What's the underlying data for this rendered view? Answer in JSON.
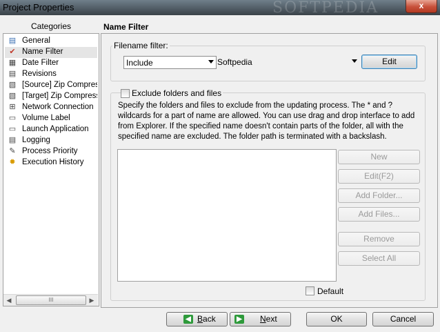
{
  "window": {
    "title": "Project Properties",
    "close_glyph": "x",
    "watermark": "SOFTPEDIA"
  },
  "categories": {
    "header": "Categories",
    "items": [
      {
        "label": "General",
        "icon": "general-icon",
        "glyph": "▤"
      },
      {
        "label": "Name Filter",
        "icon": "name-filter-icon",
        "glyph": "✔",
        "selected": true
      },
      {
        "label": "Date Filter",
        "icon": "date-filter-icon",
        "glyph": "▦"
      },
      {
        "label": "Revisions",
        "icon": "revisions-icon",
        "glyph": "▤"
      },
      {
        "label": "[Source] Zip Compress",
        "icon": "source-zip-icon",
        "glyph": "▧"
      },
      {
        "label": "[Target] Zip Compress",
        "icon": "target-zip-icon",
        "glyph": "▧"
      },
      {
        "label": "Network Connection",
        "icon": "network-icon",
        "glyph": "⊞"
      },
      {
        "label": "Volume Label",
        "icon": "volume-label-icon",
        "glyph": "▭"
      },
      {
        "label": "Launch Application",
        "icon": "launch-app-icon",
        "glyph": "▭"
      },
      {
        "label": "Logging",
        "icon": "logging-icon",
        "glyph": "▤"
      },
      {
        "label": "Process Priority",
        "icon": "priority-icon",
        "glyph": "✎"
      },
      {
        "label": "Execution History",
        "icon": "history-icon",
        "glyph": "✹"
      }
    ],
    "scroll_thumb_grip": "III"
  },
  "panel": {
    "title": "Name Filter",
    "filename_filter": {
      "group_label": "Filename filter:",
      "mode_value": "Include",
      "pattern_value": "Softpedia",
      "edit_label": "Edit"
    },
    "exclude": {
      "checkbox_label": "Exclude folders and files",
      "description": "Specify the folders and files to exclude from the updating process. The * and ? wildcards for a part of name are allowed. You can use drag and drop interface to add from Explorer. If the specified name doesn't contain parts of the folder, all with the specified name are excluded. The folder path is terminated with a backslash.",
      "buttons": {
        "new": "New",
        "edit": "Edit(F2)",
        "add_folder": "Add Folder...",
        "add_files": "Add Files...",
        "remove": "Remove",
        "select_all": "Select All"
      },
      "default_label": "Default"
    }
  },
  "footer": {
    "back": {
      "prefix": "",
      "accel": "B",
      "rest": "ack"
    },
    "next": {
      "prefix": "",
      "accel": "N",
      "rest": "ext"
    },
    "ok": "OK",
    "cancel": "Cancel"
  },
  "colors": {
    "nav_icon_green": "#2e9a3b",
    "close_button_red": "#c7503a"
  }
}
